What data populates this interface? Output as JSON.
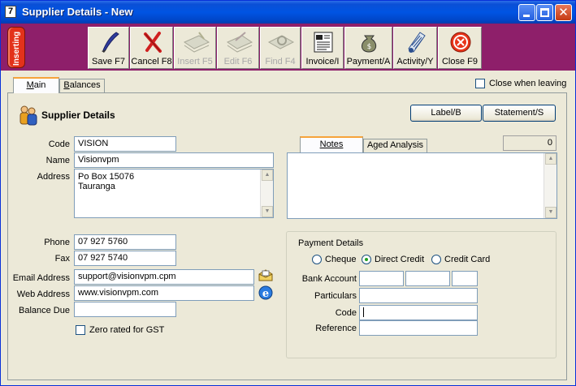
{
  "window": {
    "title": "Supplier Details - New",
    "app_icon_text": "7"
  },
  "toolbar": {
    "status_label": "Inserting",
    "buttons": [
      {
        "label": "Save F7",
        "icon": "quill-pen-icon",
        "enabled": true
      },
      {
        "label": "Cancel F8",
        "icon": "red-x-icon",
        "enabled": true
      },
      {
        "label": "Insert F5",
        "icon": "insert-record-icon",
        "enabled": false
      },
      {
        "label": "Edit F6",
        "icon": "edit-record-icon",
        "enabled": false
      },
      {
        "label": "Find F4",
        "icon": "find-icon",
        "enabled": false
      },
      {
        "label": "Invoice/I",
        "icon": "invoice-icon",
        "enabled": true
      },
      {
        "label": "Payment/A",
        "icon": "money-bag-icon",
        "enabled": true
      },
      {
        "label": "Activity/Y",
        "icon": "activity-scroll-icon",
        "enabled": true
      },
      {
        "label": "Close F9",
        "icon": "close-circle-icon",
        "enabled": true
      }
    ]
  },
  "tabs": {
    "main": {
      "label_u": "M",
      "label_rest": "ain"
    },
    "balances": {
      "label_u": "B",
      "label_rest": "alances"
    }
  },
  "close_when_leaving": {
    "label": "Close when leaving",
    "checked": false
  },
  "section": {
    "title": "Supplier Details",
    "icon": "people-icon"
  },
  "buttons": {
    "label": "Label/B",
    "statement": "Statement/S"
  },
  "fields": {
    "code": {
      "label": "Code",
      "value": "VISION"
    },
    "name": {
      "label": "Name",
      "value": "Visionvpm"
    },
    "address": {
      "label": "Address",
      "line1": "Po Box 15076",
      "line2": "Tauranga"
    },
    "phone": {
      "label": "Phone",
      "value": "07 927 5760"
    },
    "fax": {
      "label": "Fax",
      "value": "07 927 5740"
    },
    "email": {
      "label": "Email Address",
      "value": "support@visionvpm.cpm"
    },
    "web": {
      "label": "Web Address",
      "value": "www.visionvpm.com"
    },
    "balance_due": {
      "label": "Balance Due",
      "value": ""
    },
    "zero_rated": {
      "label": "Zero rated for GST",
      "checked": false
    }
  },
  "notes_tabs": {
    "notes": "Notes",
    "aged": "Aged Analysis",
    "counter": "0"
  },
  "payment": {
    "group_label": "Payment Details",
    "methods": [
      {
        "label": "Cheque",
        "selected": false
      },
      {
        "label": "Direct Credit",
        "selected": true
      },
      {
        "label": "Credit Card",
        "selected": false
      }
    ],
    "bank_account_label": "Bank Account",
    "particulars_label": "Particulars",
    "code_label": "Code",
    "reference_label": "Reference"
  }
}
